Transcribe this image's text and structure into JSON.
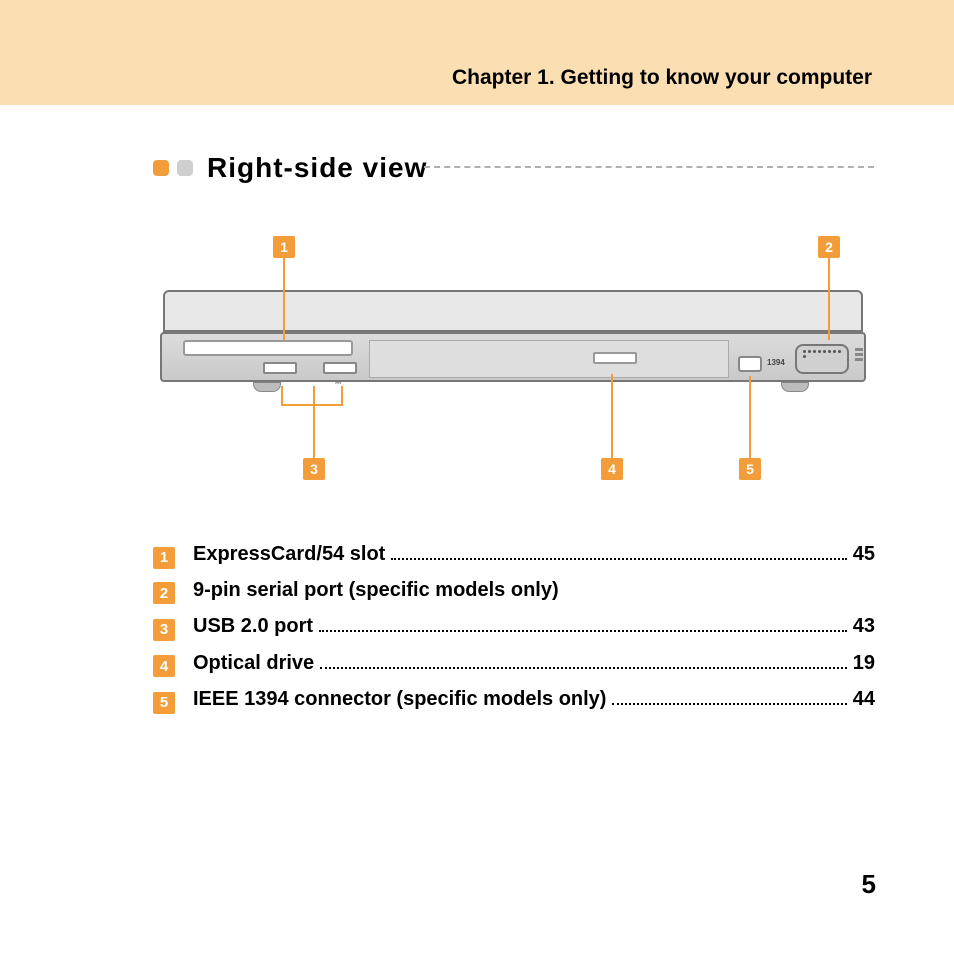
{
  "chapter_title": "Chapter 1. Getting to know your computer",
  "section_title": "Right-side view",
  "callouts": {
    "c1": "1",
    "c2": "2",
    "c3": "3",
    "c4": "4",
    "c5": "5"
  },
  "diagram_labels": {
    "ieee_text": "1394"
  },
  "legend": [
    {
      "num": "1",
      "label": "ExpressCard/54 slot",
      "page": "45"
    },
    {
      "num": "2",
      "label": "9-pin serial port (specific models only)",
      "page": ""
    },
    {
      "num": "3",
      "label": "USB 2.0 port",
      "page": "43"
    },
    {
      "num": "4",
      "label": "Optical drive",
      "page": "19"
    },
    {
      "num": "5",
      "label": "IEEE 1394 connector (specific models only)",
      "page": "44"
    }
  ],
  "page_number": "5"
}
